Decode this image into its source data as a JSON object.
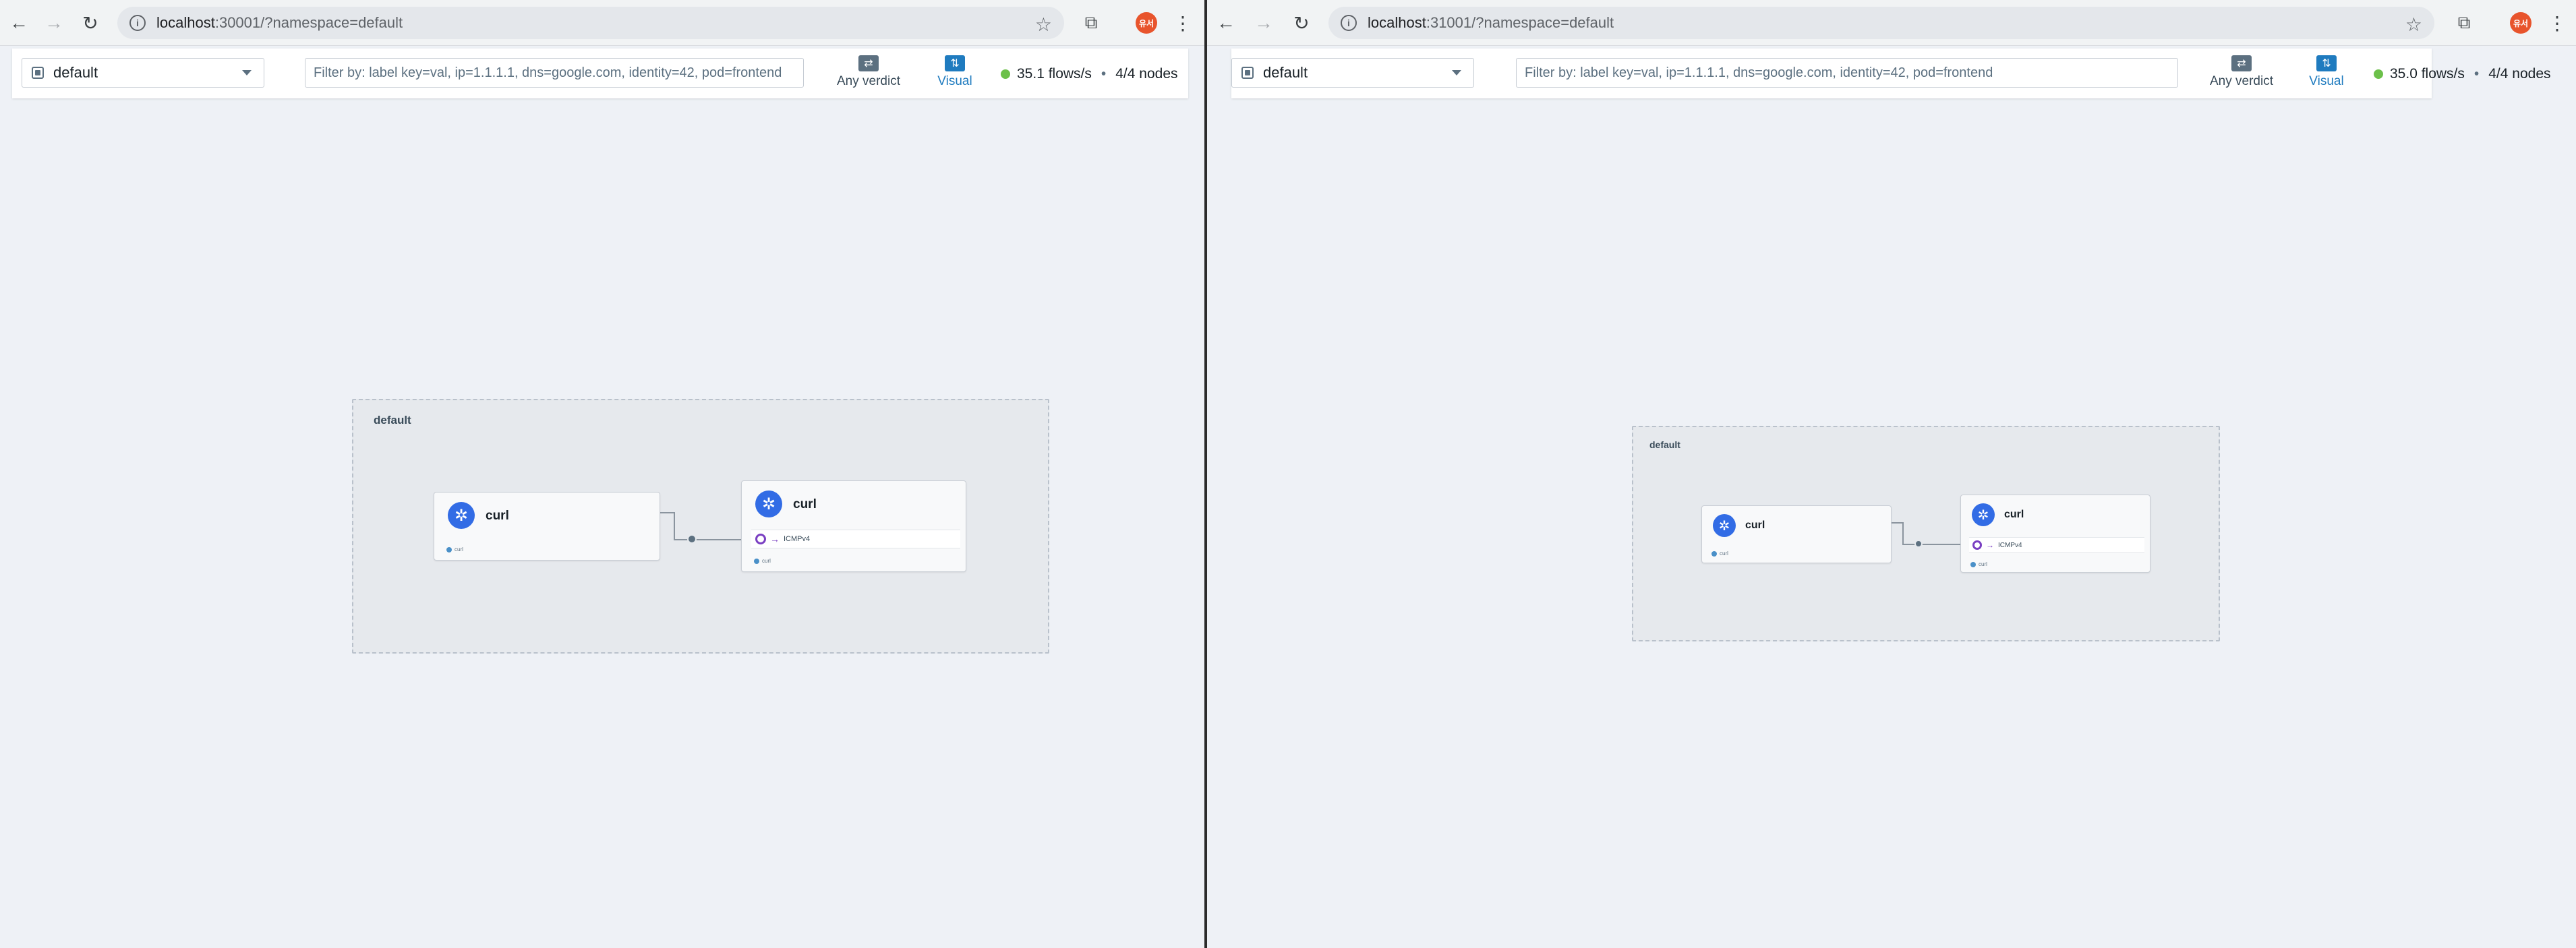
{
  "left": {
    "url_host": "localhost",
    "url_path": ":30001/?namespace=default",
    "namespace": "default",
    "filter_placeholder": "Filter by: label key=val, ip=1.1.1.1, dns=google.com, identity=42, pod=frontend",
    "verdict_label": "Any verdict",
    "visual_label": "Visual",
    "flows": "35.1 flows/s",
    "nodes": "4/4 nodes",
    "graph": {
      "namespace_label": "default",
      "source": {
        "title": "curl",
        "foot": "curl"
      },
      "dest": {
        "title": "curl",
        "protocol": "ICMPv4",
        "foot": "curl"
      }
    }
  },
  "right": {
    "url_host": "localhost",
    "url_path": ":31001/?namespace=default",
    "namespace": "default",
    "filter_placeholder": "Filter by: label key=val, ip=1.1.1.1, dns=google.com, identity=42, pod=frontend",
    "verdict_label": "Any verdict",
    "visual_label": "Visual",
    "flows": "35.0 flows/s",
    "nodes": "4/4 nodes",
    "graph": {
      "namespace_label": "default",
      "source": {
        "title": "curl",
        "foot": "curl"
      },
      "dest": {
        "title": "curl",
        "protocol": "ICMPv4",
        "foot": "curl"
      }
    }
  },
  "icons": {
    "back": "←",
    "forward": "→",
    "reload": "↻",
    "info": "i",
    "star": "☆",
    "extensions": "⧉",
    "kebab": "⋮",
    "k8s": "✲",
    "verdict": "⇄",
    "visual": "⇅",
    "arrow": "→"
  },
  "avatar_text": "유서",
  "colors": {
    "accent": "#1f7bbf",
    "status_ok": "#6cc04a",
    "k8s_blue": "#326ce5",
    "protocol_purple": "#7a3fc2"
  }
}
